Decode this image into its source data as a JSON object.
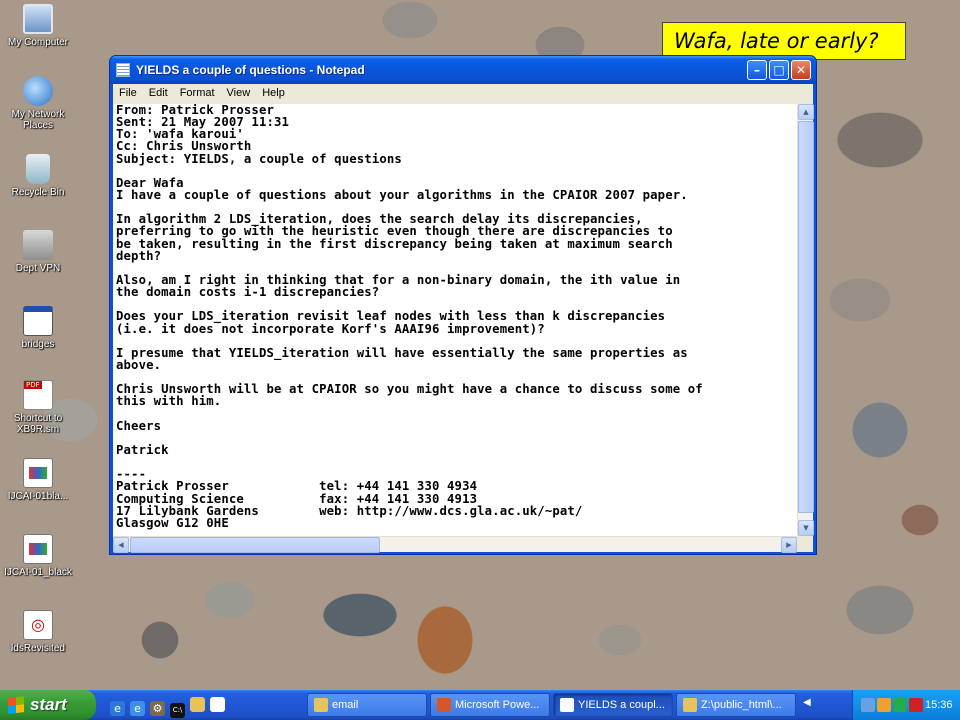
{
  "desktop": {
    "icons": [
      {
        "label": "My Computer",
        "icon": "my-computer-icon"
      },
      {
        "label": "My Network Places",
        "icon": "network-places-icon"
      },
      {
        "label": "Recycle Bin",
        "icon": "recycle-bin-icon"
      },
      {
        "label": "Dept VPN",
        "icon": "vpn-icon"
      },
      {
        "label": "bridges",
        "icon": "window-shortcut-icon"
      },
      {
        "label": "Shortcut to XB9R.sm",
        "icon": "pdf-icon"
      },
      {
        "label": "IJCAI-01bla...",
        "icon": "powerpoint-file-icon"
      },
      {
        "label": "IJCAI-01_black",
        "icon": "powerpoint-file-icon"
      },
      {
        "label": "ldsRevisited",
        "icon": "document-icon"
      }
    ]
  },
  "annotation": {
    "text": "Wafa, late or early?"
  },
  "notepad": {
    "title": "YIELDS a couple of questions - Notepad",
    "menu": [
      "File",
      "Edit",
      "Format",
      "View",
      "Help"
    ],
    "lines": [
      "From: Patrick Prosser",
      "Sent: 21 May 2007 11:31",
      "To: 'wafa karoui'",
      "Cc: Chris Unsworth",
      "Subject: YIELDS, a couple of questions",
      "",
      "Dear Wafa",
      "I have a couple of questions about your algorithms in the CPAIOR 2007 paper.",
      "",
      "In algorithm 2 LDS_iteration, does the search delay its discrepancies,",
      "preferring to go with the heuristic even though there are discrepancies to",
      "be taken, resulting in the first discrepancy being taken at maximum search",
      "depth?",
      "",
      "Also, am I right in thinking that for a non-binary domain, the ith value in",
      "the domain costs i-1 discrepancies?",
      "",
      "Does your LDS_iteration revisit leaf nodes with less than k discrepancies",
      "(i.e. it does not incorporate Korf's AAAI96 improvement)?",
      "",
      "I presume that YIELDS_iteration will have essentially the same properties as",
      "above.",
      "",
      "Chris Unsworth will be at CPAIOR so you might have a chance to discuss some of",
      "this with him.",
      "",
      "Cheers",
      "",
      "Patrick",
      "",
      "----",
      "Patrick Prosser            tel: +44 141 330 4934",
      "Computing Science          fax: +44 141 330 4913",
      "17 Lilybank Gardens        web: http://www.dcs.gla.ac.uk/~pat/",
      "Glasgow G12 0HE"
    ]
  },
  "taskbar": {
    "start_label": "start",
    "tasks": [
      {
        "label": "email",
        "icon": "folder-icon",
        "color": "#e8c25a"
      },
      {
        "label": "Microsoft Powe...",
        "icon": "powerpoint-icon",
        "color": "#d5562a"
      },
      {
        "label": "YIELDS a coupl...",
        "icon": "notepad-icon",
        "color": "#ffffff"
      },
      {
        "label": "Z:\\public_html\\...",
        "icon": "folder-icon",
        "color": "#e8c25a"
      }
    ],
    "clock": "15:36"
  }
}
